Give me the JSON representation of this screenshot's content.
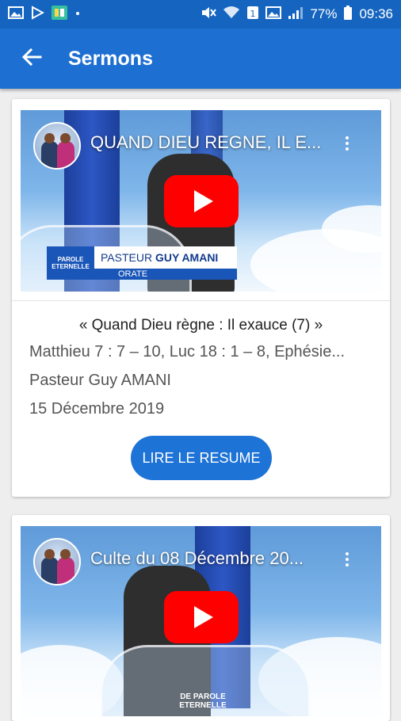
{
  "status_bar": {
    "battery": "77%",
    "time": "09:36"
  },
  "app_bar": {
    "title": "Sermons"
  },
  "sermons": [
    {
      "video_title": "QUAND DIEU REGNE, IL E...",
      "overlay_name_prefix": "PASTEUR",
      "overlay_name": "GUY AMANI",
      "overlay_role": "ORATE",
      "overlay_logo": "PAROLE ETERNELLE",
      "title": "« Quand Dieu règne : Il exauce (7) »",
      "references": "Matthieu 7 : 7 – 10, Luc 18 : 1 – 8, Ephésie...",
      "pastor": "Pasteur Guy AMANI",
      "date": "15 Décembre 2019",
      "button_label": "LIRE LE RESUME"
    },
    {
      "video_title": "Culte du 08 Décembre 20...",
      "overlay_logo": "DE PAROLE ETERNELLE"
    }
  ],
  "colors": {
    "status_bar": "#1565c0",
    "app_bar": "#1e6fd2",
    "accent_button": "#1e73d6",
    "play_button": "#ff0000"
  },
  "icons": [
    "back-arrow-icon",
    "more-vert-icon",
    "play-icon",
    "wifi-icon",
    "signal-icon",
    "battery-icon",
    "mute-icon",
    "gallery-icon",
    "play-store-icon"
  ]
}
